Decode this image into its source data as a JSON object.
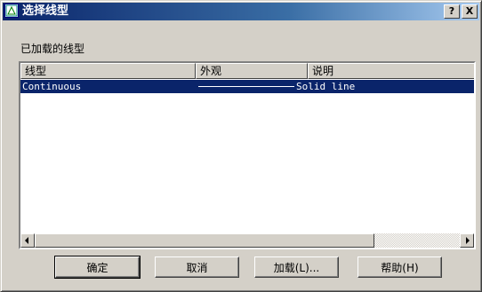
{
  "window": {
    "title": "选择线型",
    "help_button": "?",
    "close_button": "X"
  },
  "section_label": "已加载的线型",
  "list": {
    "columns": [
      "线型",
      "外观",
      "说明"
    ],
    "rows": [
      {
        "linetype": "Continuous",
        "appearance": "solid-line",
        "description": "Solid line",
        "selected": true
      }
    ]
  },
  "buttons": {
    "ok": "确定",
    "cancel": "取消",
    "load": "加载(L)...",
    "help": "帮助(H)"
  },
  "colors": {
    "title_start": "#0a246a",
    "title_end": "#a6caf0",
    "selection": "#0a246a",
    "face": "#d4d0c8"
  }
}
